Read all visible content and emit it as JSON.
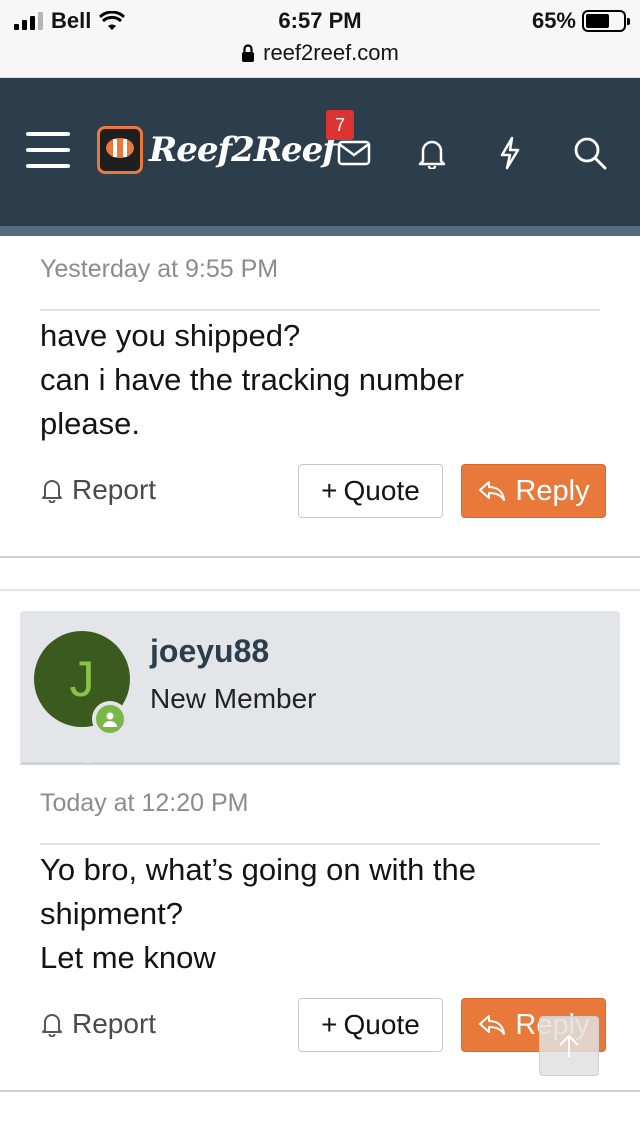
{
  "status": {
    "carrier": "Bell",
    "time": "6:57 PM",
    "battery": "65%",
    "battery_level": 0.65,
    "url": "reef2reef.com"
  },
  "header": {
    "logo_text": "Reef2Reef",
    "badge_text": "Reef2Reef",
    "inbox_count": "7",
    "icons": [
      "menu-icon",
      "mail-icon",
      "bell-icon",
      "lightning-icon",
      "search-icon"
    ]
  },
  "posts": [
    {
      "timestamp": "Yesterday at 9:55 PM",
      "lines": [
        "have you shipped?",
        "can i have the tracking number",
        "please."
      ],
      "report": "Report",
      "quote": "Quote",
      "reply": "Reply"
    },
    {
      "user": {
        "initial": "J",
        "name": "joeyu88",
        "title": "New Member"
      },
      "timestamp": "Today at 12:20 PM",
      "lines": [
        "Yo bro, what’s going on with the",
        "shipment?",
        "Let me know"
      ],
      "report": "Report",
      "quote": "Quote",
      "reply": "Reply"
    }
  ],
  "colors": {
    "header_bg": "#2c3e4c",
    "accent": "#e8793a",
    "badge": "#dd3333",
    "avatar_bg": "#3a5a1e",
    "online": "#7ab648"
  }
}
